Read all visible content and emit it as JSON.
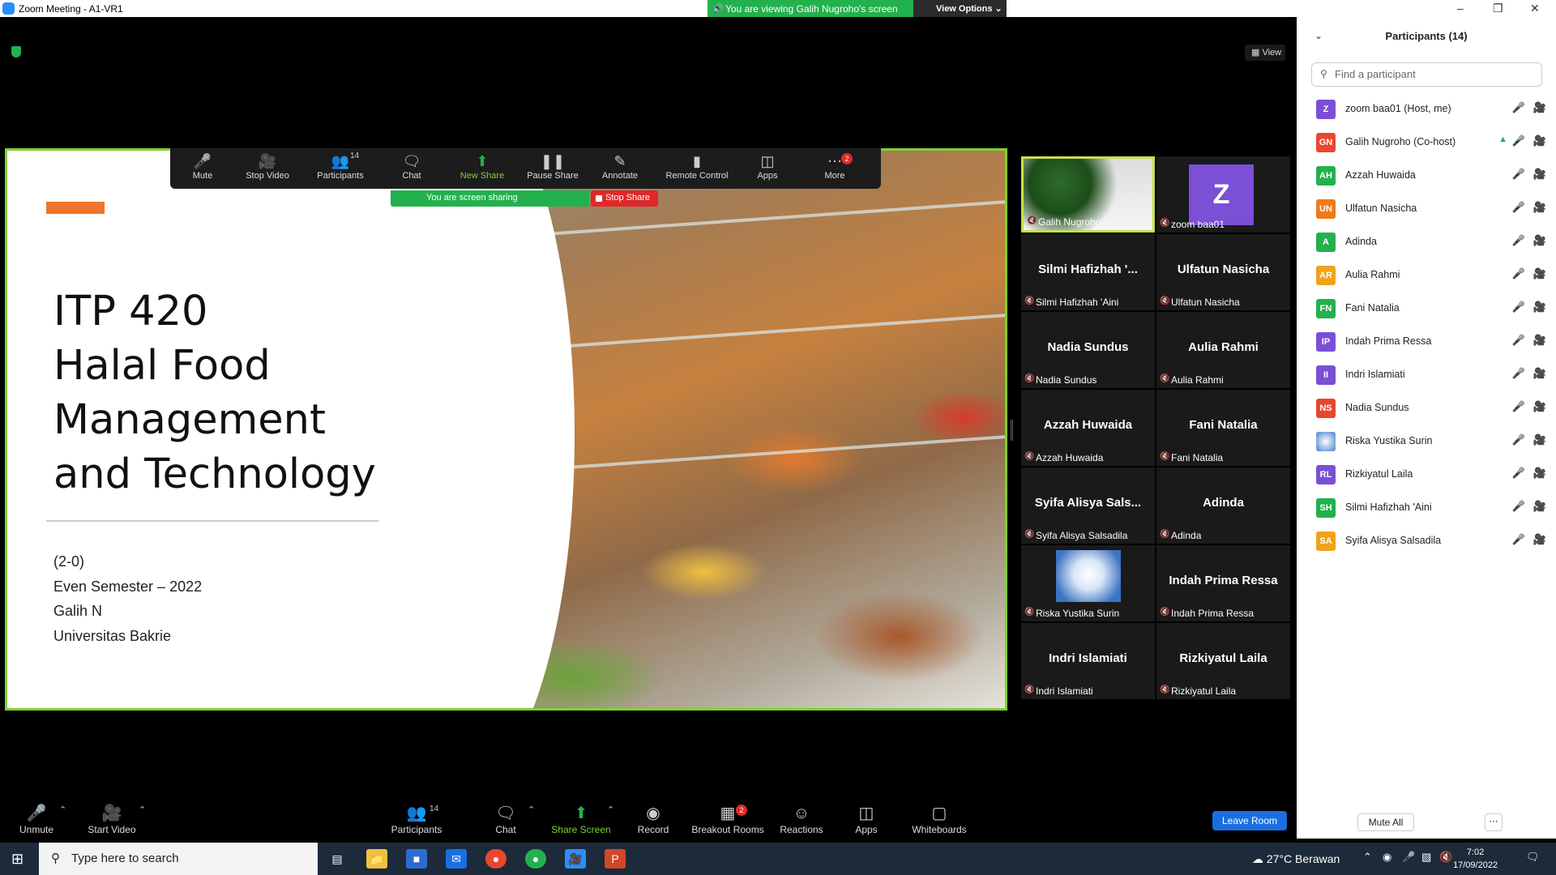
{
  "window": {
    "title": "Zoom Meeting - A1-VR1",
    "viewing_banner": "You are viewing Galih Nugroho's screen",
    "view_options": "View Options",
    "view_button": "View"
  },
  "share": {
    "toolbar": [
      {
        "label": "Mute",
        "icon": "microphone-icon"
      },
      {
        "label": "Stop Video",
        "icon": "video-camera-icon"
      },
      {
        "label": "Participants",
        "icon": "participants-icon",
        "count": "14"
      },
      {
        "label": "Chat",
        "icon": "chat-icon"
      },
      {
        "label": "New Share",
        "icon": "share-arrow-icon"
      },
      {
        "label": "Pause Share",
        "icon": "pause-icon"
      },
      {
        "label": "Annotate",
        "icon": "pencil-icon"
      },
      {
        "label": "Remote Control",
        "icon": "mouse-icon"
      },
      {
        "label": "Apps",
        "icon": "apps-icon"
      },
      {
        "label": "More",
        "icon": "more-dots-icon",
        "badge": "2"
      }
    ],
    "sharing_status": "You are screen sharing",
    "stop_share": "Stop Share"
  },
  "slide": {
    "title_lines": [
      "ITP 420",
      "Halal Food",
      "Management",
      "and Technology"
    ],
    "meta_lines": [
      "(2-0)",
      "Even Semester – 2022",
      "Galih N",
      "Universitas Bakrie"
    ]
  },
  "tiles": [
    {
      "label": "Galih Nugroho",
      "name": "",
      "kind": "video"
    },
    {
      "label": "zoom baa01",
      "name": "Z",
      "kind": "avatar"
    },
    {
      "label": "Silmi Hafizhah 'Aini",
      "name": "Silmi Hafizhah '..."
    },
    {
      "label": "Ulfatun Nasicha",
      "name": "Ulfatun Nasicha"
    },
    {
      "label": "Nadia Sundus",
      "name": "Nadia Sundus"
    },
    {
      "label": "Aulia Rahmi",
      "name": "Aulia Rahmi"
    },
    {
      "label": "Azzah Huwaida",
      "name": "Azzah Huwaida"
    },
    {
      "label": "Fani Natalia",
      "name": "Fani Natalia"
    },
    {
      "label": "Syifa Alisya Salsadila",
      "name": "Syifa Alisya Sals..."
    },
    {
      "label": "Adinda",
      "name": "Adinda"
    },
    {
      "label": "Riska Yustika Surin",
      "name": "",
      "kind": "photo"
    },
    {
      "label": "Indah Prima Ressa",
      "name": "Indah Prima Ressa"
    },
    {
      "label": "Indri Islamiati",
      "name": "Indri Islamiati"
    },
    {
      "label": "Rizkiyatul Laila",
      "name": "Rizkiyatul Laila"
    }
  ],
  "bottombar": [
    {
      "label": "Unmute",
      "icon": "microphone-muted-icon"
    },
    {
      "label": "Start Video",
      "icon": "video-off-icon"
    },
    {
      "label": "Participants",
      "icon": "participants-icon",
      "count": "14"
    },
    {
      "label": "Chat",
      "icon": "chat-icon"
    },
    {
      "label": "Share Screen",
      "icon": "share-arrow-icon"
    },
    {
      "label": "Record",
      "icon": "record-icon"
    },
    {
      "label": "Breakout Rooms",
      "icon": "breakout-rooms-icon",
      "badge": "2"
    },
    {
      "label": "Reactions",
      "icon": "reactions-icon"
    },
    {
      "label": "Apps",
      "icon": "apps-icon"
    },
    {
      "label": "Whiteboards",
      "icon": "whiteboard-icon"
    }
  ],
  "leave_room": "Leave Room",
  "panel": {
    "title": "Participants (14)",
    "search_placeholder": "Find a participant",
    "mute_all": "Mute All",
    "participants": [
      {
        "initials": "Z",
        "name": "zoom baa01 (Host, me)",
        "color": "#7b4fd6"
      },
      {
        "initials": "GN",
        "name": "Galih Nugroho (Co-host)",
        "color": "#e8472e"
      },
      {
        "initials": "AH",
        "name": "Azzah Huwaida",
        "color": "#23b14d"
      },
      {
        "initials": "UN",
        "name": "Ulfatun Nasicha",
        "color": "#f07a1a"
      },
      {
        "initials": "A",
        "name": "Adinda",
        "color": "#23b14d"
      },
      {
        "initials": "AR",
        "name": "Aulia Rahmi",
        "color": "#f0a21a"
      },
      {
        "initials": "FN",
        "name": "Fani Natalia",
        "color": "#23b14d"
      },
      {
        "initials": "IP",
        "name": "Indah Prima Ressa",
        "color": "#7b4fd6"
      },
      {
        "initials": "II",
        "name": "Indri Islamiati",
        "color": "#7b4fd6"
      },
      {
        "initials": "NS",
        "name": "Nadia Sundus",
        "color": "#e8472e"
      },
      {
        "initials": "",
        "name": "Riska Yustika Surin",
        "color": "#4a7fcf"
      },
      {
        "initials": "RL",
        "name": "Rizkiyatul Laila",
        "color": "#7b4fd6"
      },
      {
        "initials": "SH",
        "name": "Silmi Hafizhah 'Aini",
        "color": "#23b14d"
      },
      {
        "initials": "SA",
        "name": "Syifa Alisya Salsadila",
        "color": "#f0a21a"
      }
    ]
  },
  "taskbar": {
    "search_placeholder": "Type here to search",
    "weather": "27°C  Berawan",
    "time": "7:02",
    "date": "17/09/2022"
  }
}
